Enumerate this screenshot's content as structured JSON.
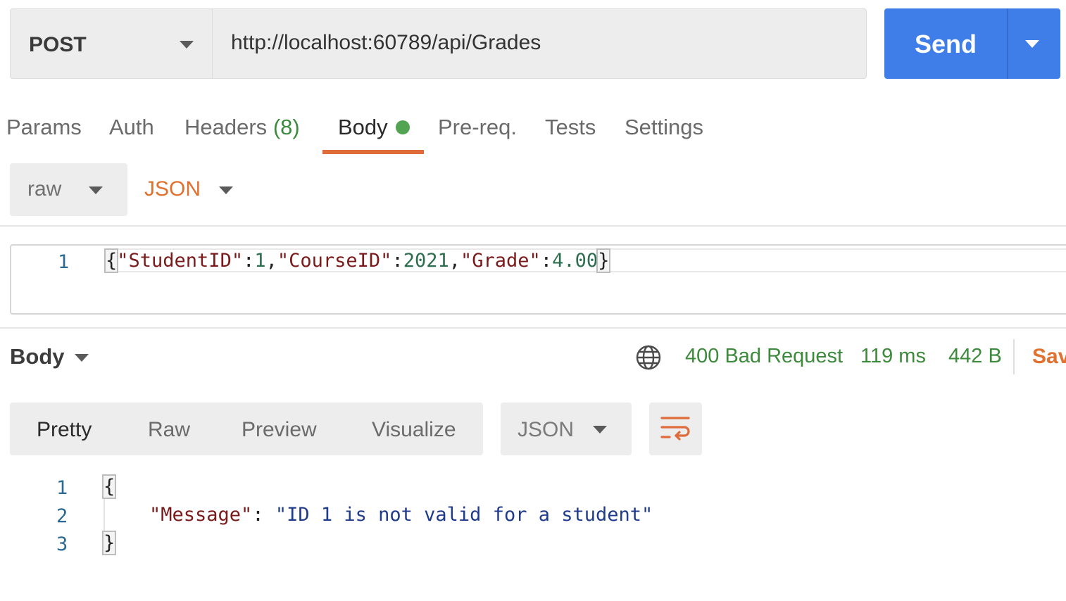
{
  "request": {
    "method": "POST",
    "url": "http://localhost:60789/api/Grades",
    "send_label": "Send",
    "send_color": "#3f7ee8"
  },
  "tabs": [
    {
      "label": "Params"
    },
    {
      "label": "Auth"
    },
    {
      "label": "Headers",
      "count": "(8)"
    },
    {
      "label": "Body",
      "active": true,
      "indicator": "green-dot"
    },
    {
      "label": "Pre-req."
    },
    {
      "label": "Tests"
    },
    {
      "label": "Settings"
    }
  ],
  "body_options": {
    "mode": "raw",
    "language": "JSON"
  },
  "request_editor": {
    "line_number": "1",
    "open_brace": "{",
    "k1": "\"StudentID\"",
    "v1": "1",
    "k2": "\"CourseID\"",
    "v2": "2021",
    "k3": "\"Grade\"",
    "v3": "4.00",
    "close_brace": "}"
  },
  "response": {
    "section_label": "Body",
    "status": "400 Bad Request",
    "time": "119 ms",
    "size": "442 B",
    "save_label": "Sav",
    "status_color": "#3c8a3c",
    "view_tabs": [
      "Pretty",
      "Raw",
      "Preview",
      "Visualize"
    ],
    "active_view": "Pretty",
    "format": "JSON",
    "lines": {
      "n1": "1",
      "n2": "2",
      "n3": "3",
      "open": "{",
      "key": "\"Message\"",
      "colon": ":",
      "value": "\"ID 1 is not valid for a student\"",
      "close": "}"
    }
  },
  "icons": {
    "network": "globe-icon",
    "wrap": "wrap-lines-icon",
    "accent": "#e06c3c"
  }
}
